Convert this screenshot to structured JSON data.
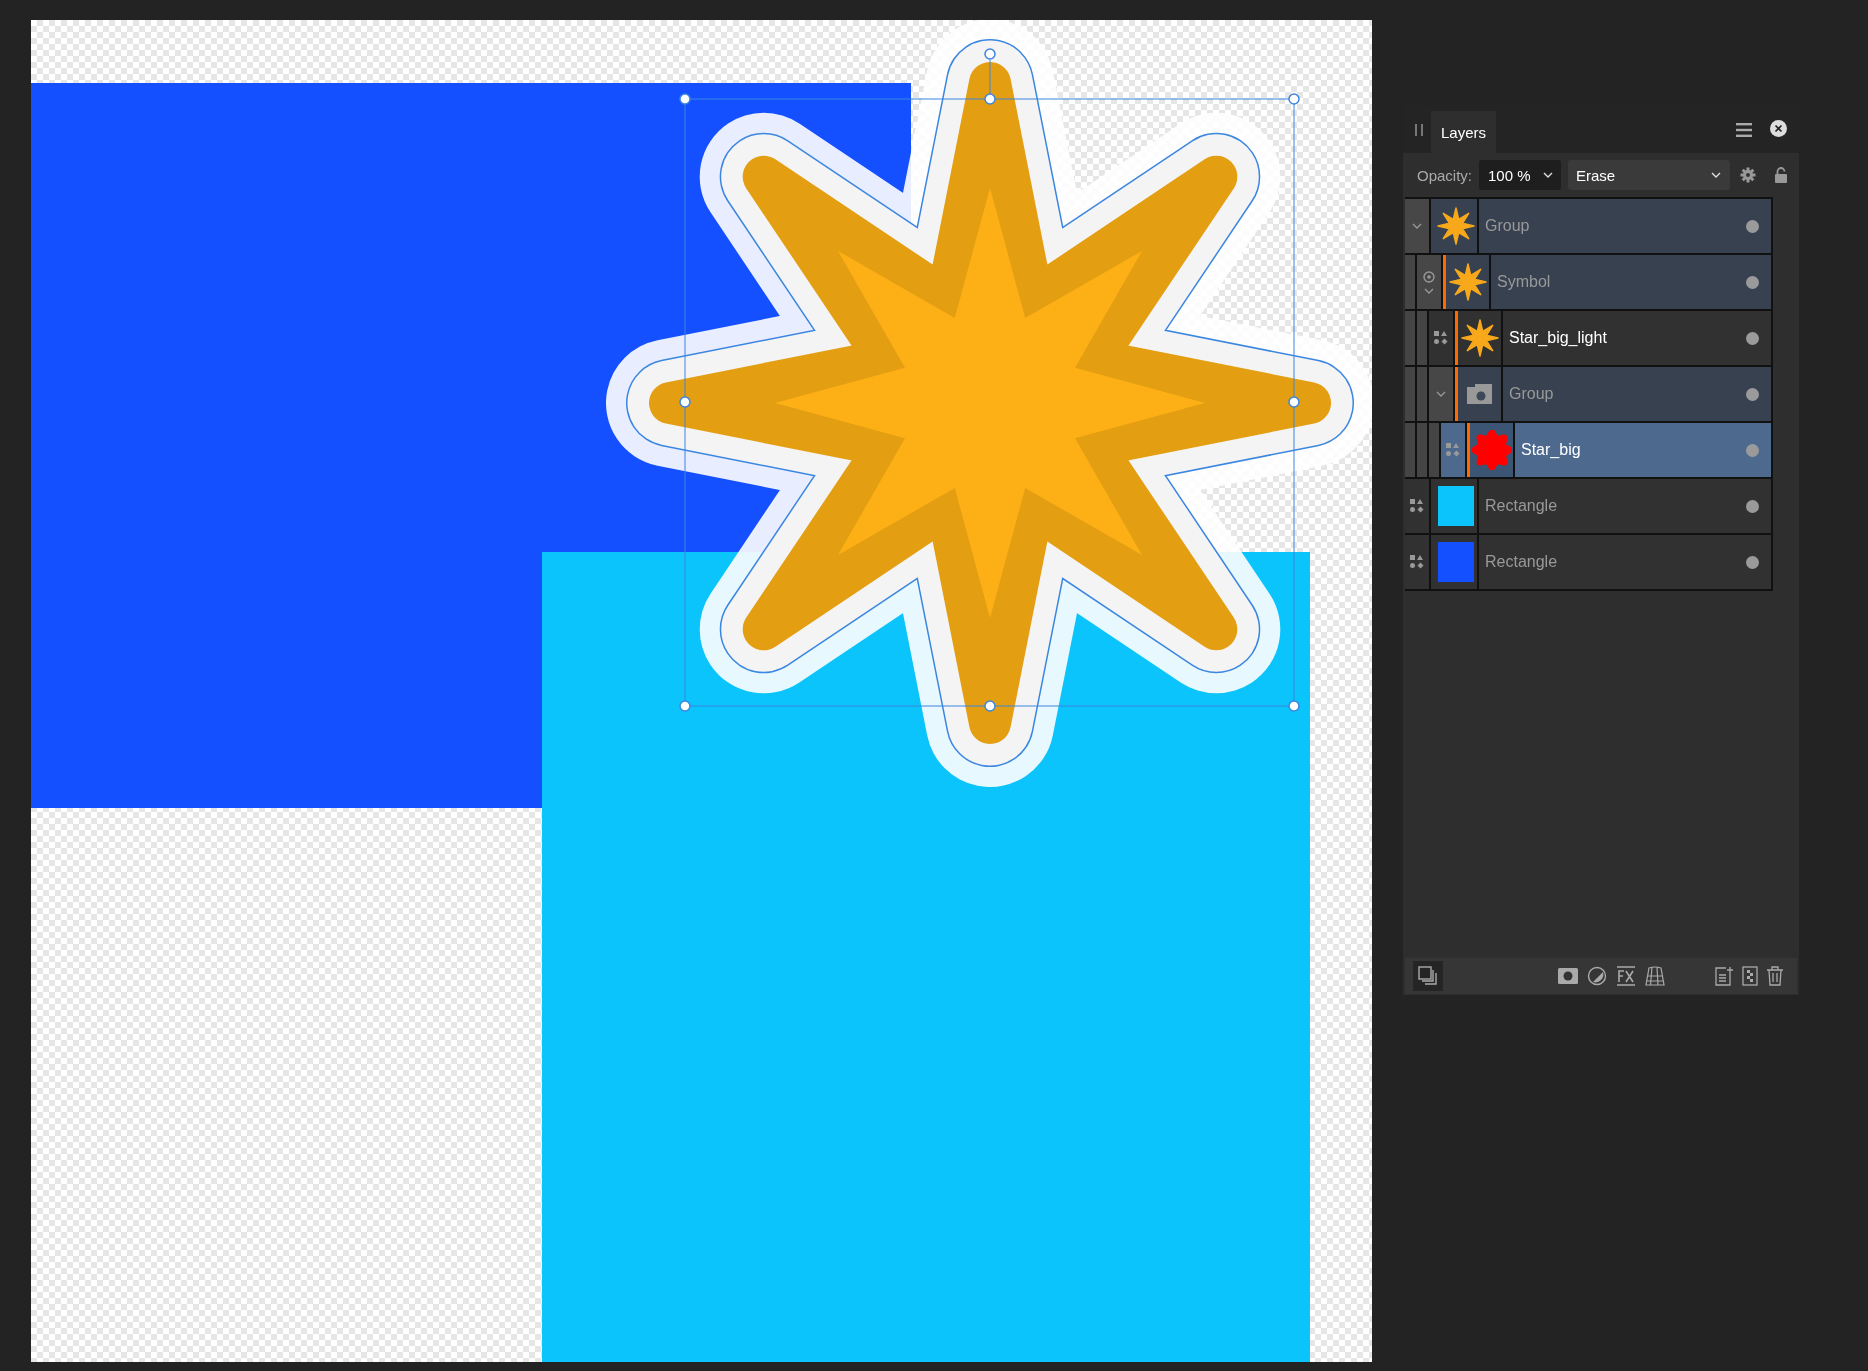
{
  "panel": {
    "tabs": [
      {
        "label": "Layers",
        "selected": true
      }
    ],
    "opacity": {
      "label": "Opacity:",
      "value": "100 %"
    },
    "blend_mode": {
      "value": "Erase"
    },
    "layers": [
      {
        "name": "Group",
        "kind": "group",
        "thumbnail": {
          "kind": "star",
          "color": "#f7a81b"
        },
        "expanded": true,
        "selected": false,
        "visible": true,
        "dimmed": true,
        "children": [
          {
            "name": "Symbol",
            "kind": "symbol",
            "thumbnail": {
              "kind": "star",
              "color": "#f7a81b"
            },
            "expanded": true,
            "selected": false,
            "visible": true,
            "dimmed": true,
            "children": [
              {
                "name": "Star_big_light",
                "kind": "shape",
                "thumbnail": {
                  "kind": "star",
                  "color": "#f7a81b"
                },
                "selected": false,
                "visible": true,
                "dimmed": false
              },
              {
                "name": "Group",
                "kind": "group",
                "thumbnail": {
                  "kind": "folder"
                },
                "expanded": true,
                "selected": false,
                "visible": true,
                "dimmed": true,
                "children": [
                  {
                    "name": "Star_big",
                    "kind": "shape",
                    "thumbnail": {
                      "kind": "flower",
                      "color": "#ff0000"
                    },
                    "selected": true,
                    "visible": true,
                    "dimmed": false
                  }
                ]
              }
            ]
          }
        ]
      },
      {
        "name": "Rectangle",
        "kind": "shape",
        "thumbnail": {
          "kind": "swatch",
          "color": "#0bc4fb"
        },
        "selected": false,
        "visible": true,
        "dimmed": true
      },
      {
        "name": "Rectangle",
        "kind": "shape",
        "thumbnail": {
          "kind": "swatch",
          "color": "#1450ff"
        },
        "selected": false,
        "visible": true,
        "dimmed": true
      }
    ]
  }
}
